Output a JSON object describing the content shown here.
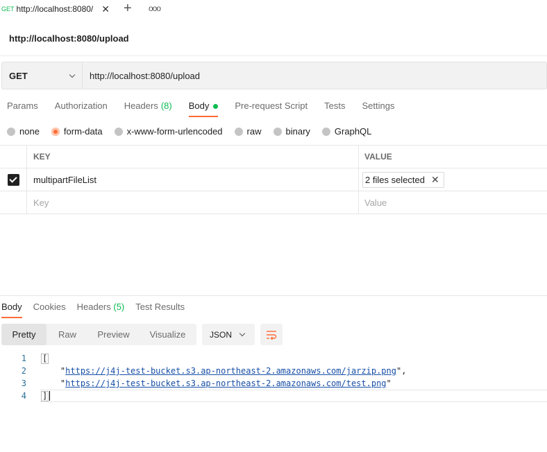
{
  "tab": {
    "method": "GET",
    "url": "http://localhost:8080/",
    "close_icon": "close-icon",
    "add_icon": "plus-icon",
    "more_icon": "more-icon",
    "add_glyph": "+",
    "more_glyph": "ooo"
  },
  "request": {
    "title": "http://localhost:8080/upload",
    "method": "GET",
    "url": "http://localhost:8080/upload"
  },
  "request_tabs": [
    {
      "label": "Params"
    },
    {
      "label": "Authorization"
    },
    {
      "label": "Headers",
      "count": "(8)"
    },
    {
      "label": "Body"
    },
    {
      "label": "Pre-request Script"
    },
    {
      "label": "Tests"
    },
    {
      "label": "Settings"
    }
  ],
  "body_types": [
    {
      "label": "none"
    },
    {
      "label": "form-data",
      "selected": true
    },
    {
      "label": "x-www-form-urlencoded"
    },
    {
      "label": "raw"
    },
    {
      "label": "binary"
    },
    {
      "label": "GraphQL"
    }
  ],
  "form_table": {
    "headers": {
      "key": "KEY",
      "value": "VALUE"
    },
    "rows": [
      {
        "checked": true,
        "key": "multipartFileList",
        "value": "2 files selected"
      }
    ],
    "placeholders": {
      "key": "Key",
      "value": "Value"
    }
  },
  "response_tabs": [
    {
      "label": "Body"
    },
    {
      "label": "Cookies"
    },
    {
      "label": "Headers",
      "count": "(5)"
    },
    {
      "label": "Test Results"
    }
  ],
  "view_modes": [
    "Pretty",
    "Raw",
    "Preview",
    "Visualize"
  ],
  "language": "JSON",
  "code": {
    "line_numbers": [
      "1",
      "2",
      "3",
      "4"
    ],
    "open_bracket": "[",
    "close_bracket": "]",
    "urls": [
      "https://j4j-test-bucket.s3.ap-northeast-2.amazonaws.com/jarzip.png",
      "https://j4j-test-bucket.s3.ap-northeast-2.amazonaws.com/test.png"
    ]
  },
  "colors": {
    "accent": "#ff6c37",
    "success": "#0cbb52"
  }
}
